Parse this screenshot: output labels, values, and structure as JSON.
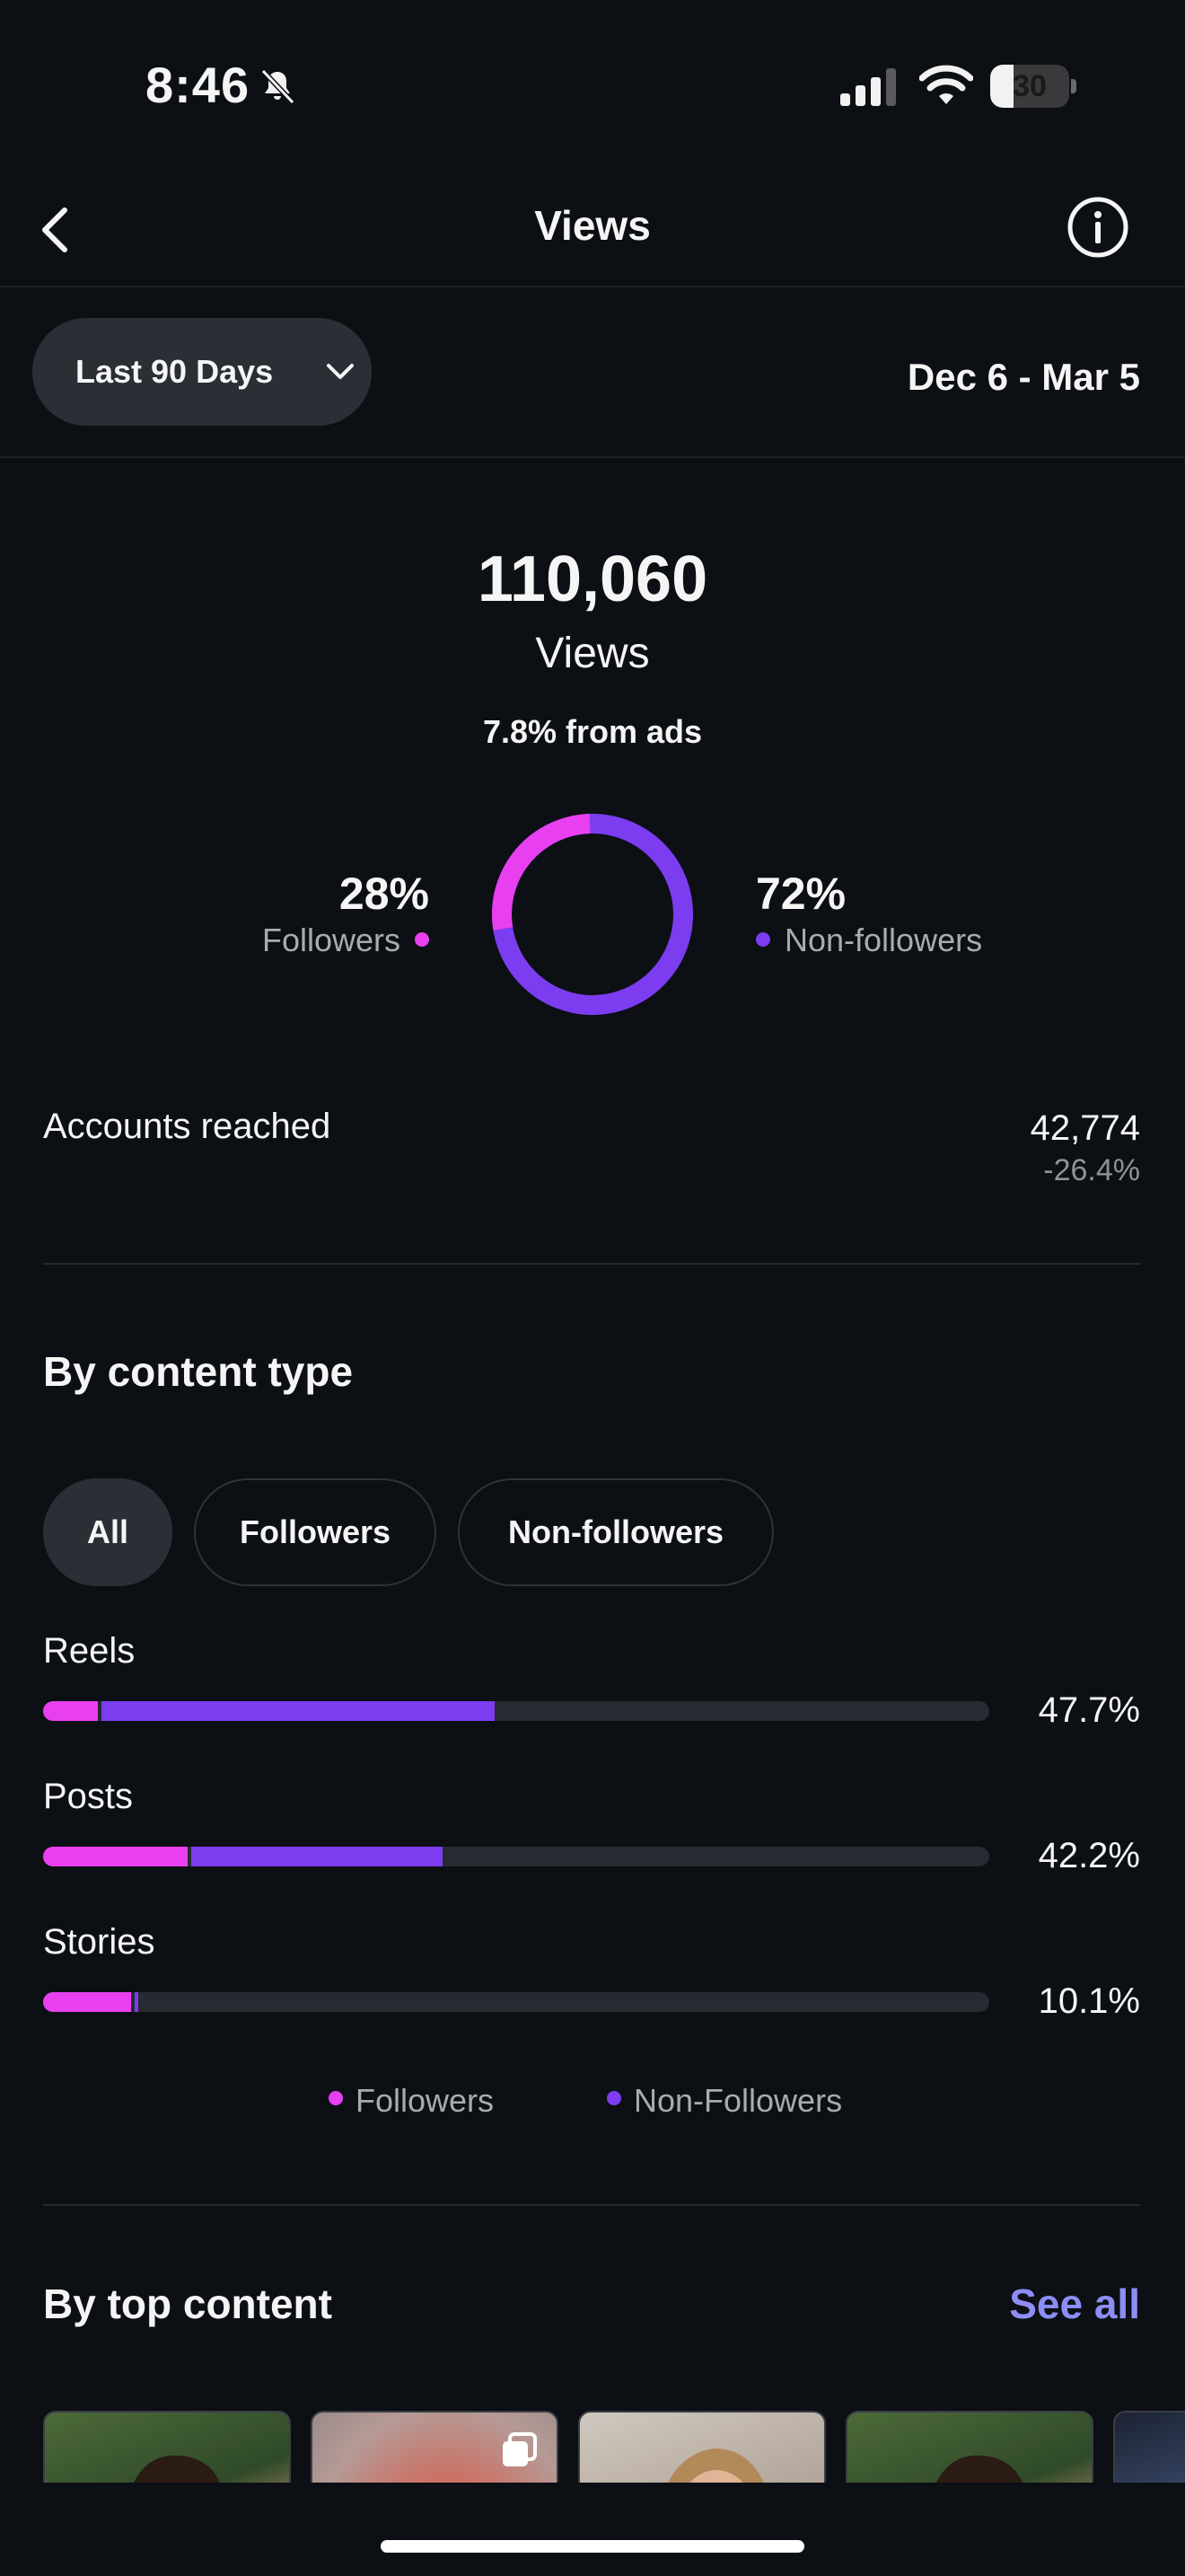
{
  "status_bar": {
    "time": "8:46",
    "battery": "30",
    "battery_level": 0.3
  },
  "nav": {
    "title": "Views"
  },
  "filters": {
    "range_label": "Last 90 Days",
    "date_range": "Dec 6 - Mar 5"
  },
  "summary": {
    "total": "110,060",
    "total_label": "Views",
    "ads_text": "7.8% from ads",
    "followers_pct": "28%",
    "followers_label": "Followers",
    "nonfollowers_pct": "72%",
    "nonfollowers_label": "Non-followers",
    "followers_share": 0.28
  },
  "reach": {
    "label": "Accounts reached",
    "value": "42,774",
    "change": "-26.4%"
  },
  "content_type": {
    "title": "By content type",
    "chips": [
      "All",
      "Followers",
      "Non-followers"
    ],
    "active_chip": "All",
    "rows": [
      {
        "label": "Reels",
        "pct": "47.7%",
        "followers_fraction": 0.058,
        "nonfollowers_fraction": 0.419
      },
      {
        "label": "Posts",
        "pct": "42.2%",
        "followers_fraction": 0.153,
        "nonfollowers_fraction": 0.269
      },
      {
        "label": "Stories",
        "pct": "10.1%",
        "followers_fraction": 0.093,
        "nonfollowers_fraction": 0.008
      }
    ],
    "legend": [
      "Followers",
      "Non-Followers"
    ]
  },
  "top_content": {
    "title": "By top content",
    "see_all": "See all"
  },
  "colors": {
    "followers": "#e83ff0",
    "nonfollowers": "#7c3cf0",
    "track": "#262a31",
    "link": "#8c8ef6"
  }
}
